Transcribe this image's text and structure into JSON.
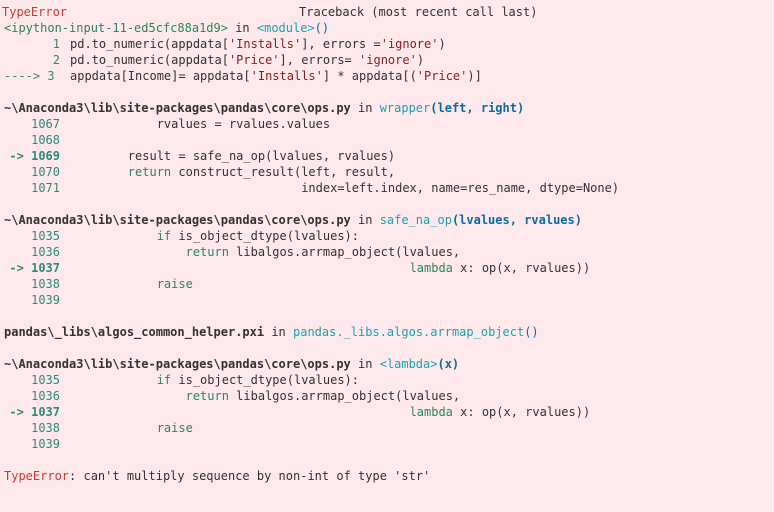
{
  "header": {
    "errtype": "TypeError",
    "tb": "Traceback (most recent call last)"
  },
  "f0": {
    "loc_pre": "<ipython-input-11-ed5cfc88a1d9>",
    "loc_in": " in ",
    "loc_fn": "<module>",
    "loc_post": "()",
    "lines": [
      {
        "n": "1",
        "pre": "pd.to_numeric(appdata[",
        "s1": "'Installs'",
        "mid": "], errors =",
        "s2": "'ignore'",
        "post": ")"
      },
      {
        "n": "2",
        "pre": "pd.to_numeric(appdata[",
        "s1": "'Price'",
        "mid": "], errors= ",
        "s2": "'ignore'",
        "post": ")"
      }
    ],
    "cur": {
      "arrow": "----> 3 ",
      "p1": "appdata[Income]= appdata[",
      "s1": "'Installs'",
      "p2": "] * appdata[(",
      "s2": "'Price'",
      "p3": ")]"
    }
  },
  "f1": {
    "loc_path": "~\\Anaconda3\\lib\\site-packages\\pandas\\core\\ops.py",
    "loc_in": " in ",
    "fn": "wrapper",
    "args": "(left, right)",
    "l1067": {
      "n": "1067",
      "txt": "            rvalues = rvalues.values"
    },
    "l1068": {
      "n": "1068",
      "txt": ""
    },
    "l1069": {
      "n": "-> 1069",
      "txt": "        result = safe_na_op(lvalues, rvalues)"
    },
    "l1070": {
      "n": "1070",
      "pre": "        ",
      "kw": "return",
      "rest": " construct_result(left, result,"
    },
    "l1071": {
      "n": "1071",
      "txt": "                                index=left.index, name=res_name, dtype=None)"
    }
  },
  "f2": {
    "loc_path": "~\\Anaconda3\\lib\\site-packages\\pandas\\core\\ops.py",
    "loc_in": " in ",
    "fn": "safe_na_op",
    "args": "(lvalues, rvalues)",
    "l1035": {
      "n": "1035",
      "pre": "            ",
      "kw": "if",
      "rest": " is_object_dtype(lvalues):"
    },
    "l1036": {
      "n": "1036",
      "pre": "                ",
      "kw": "return",
      "rest": " libalgos.arrmap_object(lvalues,"
    },
    "l1037": {
      "n": "-> 1037",
      "pre": "                                               ",
      "kw": "lambda",
      "rest": " x: op(x, rvalues))"
    },
    "l1038": {
      "n": "1038",
      "pre": "            ",
      "kw": "raise",
      "rest": ""
    },
    "l1039": {
      "n": "1039",
      "txt": ""
    }
  },
  "f3": {
    "loc_path": "pandas\\_libs\\algos_common_helper.pxi",
    "loc_in": " in ",
    "fn": "pandas._libs.algos.arrmap_object",
    "args": "()"
  },
  "f4": {
    "loc_path": "~\\Anaconda3\\lib\\site-packages\\pandas\\core\\ops.py",
    "loc_in": " in ",
    "fn": "<lambda>",
    "args": "(x)",
    "l1035": {
      "n": "1035",
      "pre": "            ",
      "kw": "if",
      "rest": " is_object_dtype(lvalues):"
    },
    "l1036": {
      "n": "1036",
      "pre": "                ",
      "kw": "return",
      "rest": " libalgos.arrmap_object(lvalues,"
    },
    "l1037": {
      "n": "-> 1037",
      "pre": "                                               ",
      "kw": "lambda",
      "rest": " x: op(x, rvalues))"
    },
    "l1038": {
      "n": "1038",
      "pre": "            ",
      "kw": "raise",
      "rest": ""
    },
    "l1039": {
      "n": "1039",
      "txt": ""
    }
  },
  "final": {
    "errtype": "TypeError",
    "msg": ": can't multiply sequence by non-int of type 'str'"
  }
}
